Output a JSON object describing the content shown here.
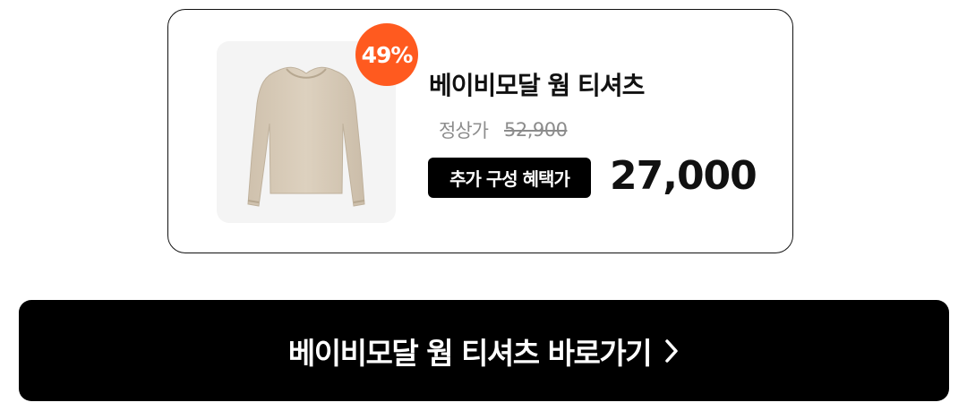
{
  "product": {
    "image_alt": "베이비모달 웜 티셔츠",
    "discount_badge": "49%",
    "title": "베이비모달 웜 티셔츠",
    "regular_price_label": "정상가",
    "regular_price": "52,900",
    "benefit_label": "추가 구성 혜택가",
    "sale_price": "27,000"
  },
  "cta": {
    "label": "베이비모달 웜 티셔츠 바로가기",
    "icon": "chevron-right-icon"
  },
  "colors": {
    "accent": "#ff5a1f",
    "cta_background": "#000000",
    "image_background": "#f4f4f4",
    "muted_text": "#8c8c8c",
    "shirt": "#d8cbb8"
  }
}
